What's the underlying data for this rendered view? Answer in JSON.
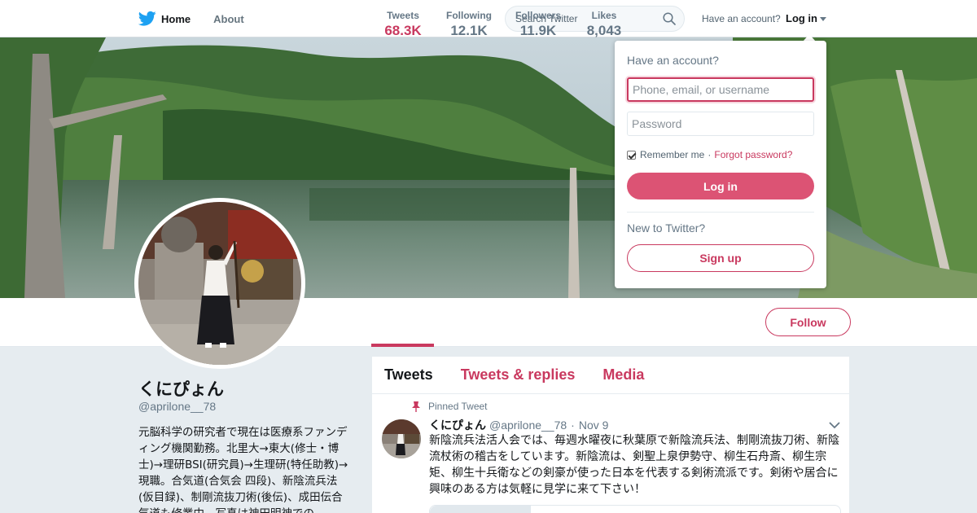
{
  "nav": {
    "home": "Home",
    "about": "About",
    "search_placeholder": "Search Twitter",
    "account_question": "Have an account?",
    "login": "Log in"
  },
  "colors": {
    "accent": "#c9395f",
    "login_button": "#dc5374",
    "twitter_blue": "#1da1f2"
  },
  "stats": [
    {
      "label": "Tweets",
      "value": "68.3K",
      "active": true
    },
    {
      "label": "Following",
      "value": "12.1K"
    },
    {
      "label": "Followers",
      "value": "11.9K"
    },
    {
      "label": "Likes",
      "value": "8,043"
    }
  ],
  "follow_label": "Follow",
  "profile": {
    "name": "くにぴょん",
    "handle": "@aprilone__78",
    "bio": "元脳科学の研究者で現在は医療系ファンディング機関勤務。北里大→東大(修士・博士)→理研BSI(研究員)→生理研(特任助教)→現職。合気道(合気会 四段)、新陰流兵法(仮目録)、制剛流抜刀術(後伝)、成田伝合気道も修業中。写真は神田明神での"
  },
  "timeline": {
    "tabs": [
      "Tweets",
      "Tweets & replies",
      "Media"
    ],
    "pinned_label": "Pinned Tweet",
    "tweet": {
      "name": "くにぴょん",
      "handle": "@aprilone__78",
      "date": "Nov 9",
      "text": "新陰流兵法活人会では、毎週水曜夜に秋葉原で新陰流兵法、制剛流抜刀術、新陰流杖術の稽古をしています。新陰流は、剣聖上泉伊勢守、柳生石舟斎、柳生宗矩、柳生十兵衛などの剣豪が使った日本を代表する剣術流派です。剣術や居合に興味のある方は気軽に見学に来て下さい！"
    }
  },
  "login_dropdown": {
    "title": "Have an account?",
    "phone_placeholder": "Phone, email, or username",
    "password_placeholder": "Password",
    "remember": "Remember me",
    "separator": "·",
    "forgot": "Forgot password?",
    "login_button": "Log in",
    "new_text": "New to Twitter?",
    "signup_button": "Sign up"
  }
}
